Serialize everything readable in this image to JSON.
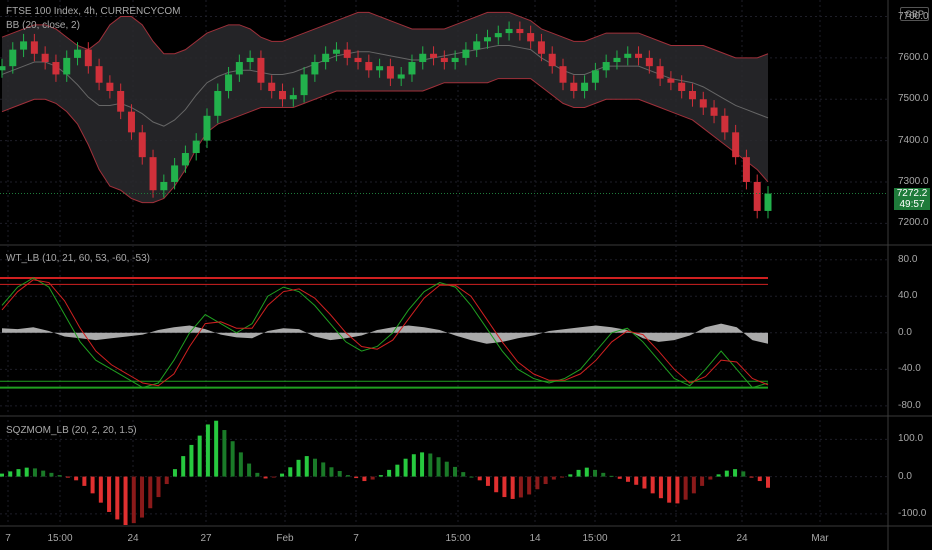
{
  "header": {
    "title": "FTSE 100 Index, 4h, CURRENCYCOM",
    "currency": "GBP"
  },
  "price_badge": {
    "price": "7272.2",
    "countdown": "49:57"
  },
  "colors": {
    "up": "#22b14c",
    "down": "#d0303a",
    "bb_band": "#a0303a",
    "bb_fill": "#2a2a2e",
    "bb_basis": "#666666",
    "wt_hist": "#c8c8c8",
    "wt_upper": "#d02020",
    "wt_lower": "#20a020",
    "grid": "#1e1e28",
    "separator": "#3a3a3a"
  },
  "chart_data": [
    {
      "type": "candlestick",
      "title": "FTSE 100 Index, 4h, CURRENCYCOM",
      "indicator": "BB (20, close, 2)",
      "ylim": [
        7150,
        7740
      ],
      "yticks": [
        "7700.0",
        "7600.0",
        "7500.0",
        "7400.0",
        "7300.0",
        "7200.0"
      ],
      "xticks": [
        "7",
        "15:00",
        "24",
        "27",
        "Feb",
        "7",
        "15:00",
        "14",
        "15:00",
        "21",
        "24",
        "Mar"
      ],
      "close": [
        7580,
        7620,
        7640,
        7610,
        7590,
        7560,
        7600,
        7620,
        7580,
        7540,
        7520,
        7470,
        7420,
        7360,
        7280,
        7300,
        7340,
        7370,
        7400,
        7460,
        7520,
        7560,
        7590,
        7600,
        7540,
        7520,
        7500,
        7510,
        7560,
        7590,
        7610,
        7620,
        7600,
        7590,
        7570,
        7580,
        7550,
        7560,
        7590,
        7610,
        7600,
        7590,
        7600,
        7620,
        7640,
        7650,
        7660,
        7670,
        7660,
        7640,
        7610,
        7580,
        7540,
        7520,
        7540,
        7570,
        7590,
        7600,
        7610,
        7600,
        7580,
        7550,
        7540,
        7520,
        7500,
        7480,
        7460,
        7420,
        7360,
        7300,
        7230,
        7272
      ],
      "upper": [
        7650,
        7660,
        7670,
        7680,
        7680,
        7670,
        7650,
        7630,
        7620,
        7640,
        7680,
        7700,
        7700,
        7680,
        7640,
        7610,
        7610,
        7620,
        7640,
        7660,
        7670,
        7680,
        7680,
        7670,
        7650,
        7640,
        7640,
        7650,
        7660,
        7670,
        7680,
        7690,
        7700,
        7710,
        7710,
        7700,
        7690,
        7680,
        7670,
        7670,
        7670,
        7670,
        7680,
        7690,
        7700,
        7710,
        7710,
        7710,
        7700,
        7690,
        7670,
        7660,
        7650,
        7640,
        7640,
        7650,
        7660,
        7660,
        7660,
        7660,
        7650,
        7640,
        7630,
        7630,
        7630,
        7630,
        7620,
        7610,
        7600,
        7600,
        7600,
        7610
      ],
      "lower": [
        7470,
        7480,
        7490,
        7500,
        7500,
        7490,
        7470,
        7440,
        7390,
        7330,
        7290,
        7280,
        7260,
        7250,
        7250,
        7260,
        7290,
        7330,
        7380,
        7420,
        7440,
        7450,
        7460,
        7470,
        7480,
        7480,
        7480,
        7480,
        7490,
        7500,
        7510,
        7520,
        7520,
        7520,
        7520,
        7520,
        7520,
        7520,
        7520,
        7520,
        7530,
        7540,
        7540,
        7540,
        7540,
        7540,
        7550,
        7550,
        7550,
        7550,
        7530,
        7510,
        7490,
        7480,
        7480,
        7490,
        7500,
        7500,
        7500,
        7500,
        7490,
        7480,
        7470,
        7460,
        7450,
        7430,
        7410,
        7390,
        7370,
        7350,
        7330,
        7300
      ]
    },
    {
      "type": "line",
      "title": "WT_LB (10, 21, 60, 53, -60, -53)",
      "ylim": [
        -90,
        95
      ],
      "yticks": [
        "80.0",
        "40.0",
        "0.0",
        "-40.0",
        "-80.0"
      ],
      "levels": [
        60,
        53,
        -53,
        -60
      ],
      "series": [
        {
          "values": [
            30,
            50,
            60,
            50,
            20,
            -10,
            -30,
            -40,
            -50,
            -60,
            -55,
            -30,
            0,
            20,
            10,
            0,
            10,
            40,
            50,
            45,
            30,
            10,
            -10,
            -20,
            -15,
            0,
            25,
            45,
            55,
            50,
            30,
            5,
            -20,
            -40,
            -50,
            -55,
            -50,
            -40,
            -20,
            0,
            5,
            -10,
            -30,
            -50,
            -58,
            -40,
            -20,
            -40,
            -60,
            -55
          ]
        },
        {
          "values": [
            25,
            45,
            58,
            55,
            35,
            5,
            -20,
            -35,
            -45,
            -55,
            -58,
            -45,
            -15,
            10,
            12,
            5,
            5,
            30,
            45,
            48,
            38,
            20,
            0,
            -15,
            -18,
            -8,
            15,
            38,
            52,
            52,
            40,
            15,
            -10,
            -32,
            -45,
            -52,
            -52,
            -45,
            -30,
            -10,
            2,
            -2,
            -20,
            -40,
            -55,
            -48,
            -30,
            -32,
            -50,
            -57
          ]
        }
      ],
      "hist": [
        5,
        4,
        6,
        2,
        -4,
        -6,
        -8,
        -6,
        -4,
        -2,
        3,
        6,
        8,
        4,
        -2,
        -5,
        -6,
        2,
        5,
        4,
        -4,
        -8,
        -6,
        -3,
        3,
        6,
        8,
        6,
        3,
        -3,
        -8,
        -12,
        -10,
        -6,
        -3,
        2,
        4,
        6,
        8,
        6,
        3,
        -6,
        -10,
        -8,
        -3,
        6,
        10,
        6,
        -8,
        -12
      ]
    },
    {
      "type": "bar",
      "title": "SQZMOM_LB (20, 2, 20, 1.5)",
      "ylim": [
        -130,
        160
      ],
      "yticks": [
        "100.0",
        "0.0",
        "-100.0"
      ],
      "values": [
        8,
        14,
        20,
        24,
        22,
        16,
        10,
        4,
        -2,
        -10,
        -25,
        -45,
        -70,
        -95,
        -115,
        -130,
        -125,
        -110,
        -85,
        -55,
        -20,
        20,
        55,
        85,
        110,
        140,
        150,
        125,
        95,
        65,
        35,
        10,
        -5,
        -2,
        8,
        25,
        45,
        55,
        48,
        38,
        25,
        15,
        4,
        -4,
        -12,
        -8,
        4,
        18,
        32,
        48,
        60,
        65,
        62,
        52,
        40,
        26,
        12,
        0,
        -10,
        -25,
        -42,
        -55,
        -60,
        -56,
        -48,
        -34,
        -20,
        -8,
        -2,
        6,
        18,
        24,
        18,
        10,
        2,
        -6,
        -14,
        -22,
        -32,
        -45,
        -58,
        -70,
        -72,
        -62,
        -45,
        -25,
        -8,
        6,
        16,
        20,
        14,
        -2,
        -12,
        -30
      ]
    }
  ]
}
